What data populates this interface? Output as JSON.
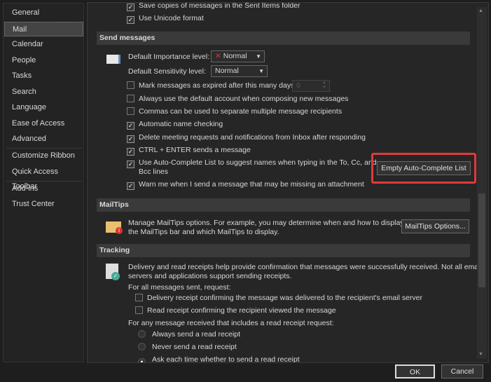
{
  "sidebar": {
    "items": [
      {
        "label": "General"
      },
      {
        "label": "Mail",
        "selected": true
      },
      {
        "label": "Calendar"
      },
      {
        "label": "People"
      },
      {
        "label": "Tasks"
      },
      {
        "label": "Search"
      },
      {
        "label": "Language"
      },
      {
        "label": "Ease of Access"
      },
      {
        "label": "Advanced"
      },
      {
        "label": "Customize Ribbon"
      },
      {
        "label": "Quick Access Toolbar"
      },
      {
        "label": "Add-ins"
      },
      {
        "label": "Trust Center"
      }
    ]
  },
  "top": {
    "save_copies": {
      "label": "Save copies of messages in the Sent Items folder",
      "checked": true
    },
    "unicode": {
      "label": "Use Unicode format",
      "checked": true
    }
  },
  "send": {
    "header": "Send messages",
    "importance_label": "Default Importance level:",
    "importance_value": "Normal",
    "sensitivity_label": "Default Sensitivity level:",
    "sensitivity_value": "Normal",
    "expire": {
      "label": "Mark messages as expired after this many days:",
      "checked": false,
      "value": "0"
    },
    "options": [
      {
        "label": "Always use the default account when composing new messages",
        "checked": false
      },
      {
        "label": "Commas can be used to separate multiple message recipients",
        "checked": false
      },
      {
        "label": "Automatic name checking",
        "checked": true
      },
      {
        "label": "Delete meeting requests and notifications from Inbox after responding",
        "checked": true
      },
      {
        "label": "CTRL + ENTER sends a message",
        "checked": true
      }
    ],
    "autocomplete": {
      "label": "Use Auto-Complete List to suggest names when typing in the To, Cc, and",
      "label2": "Bcc lines",
      "checked": true
    },
    "empty_button": "Empty Auto-Complete List",
    "warn": {
      "label": "Warn me when I send a message that may be missing an attachment",
      "checked": true
    }
  },
  "mailtips": {
    "header": "MailTips",
    "text1": "Manage MailTips options. For example, you may determine when and how to display",
    "text2": "the MailTips bar and which MailTips to display.",
    "button": "MailTips Options..."
  },
  "tracking": {
    "header": "Tracking",
    "text1": "Delivery and read receipts help provide confirmation that messages were successfully received. Not all email",
    "text2": "servers and applications support sending receipts.",
    "for_all": "For all messages sent, request:",
    "delivery": {
      "label": "Delivery receipt confirming the message was delivered to the recipient's email server",
      "checked": false
    },
    "read": {
      "label": "Read receipt confirming the recipient viewed the message",
      "checked": false
    },
    "for_any": "For any message received that includes a read receipt request:",
    "radios": [
      {
        "label": "Always send a read receipt",
        "selected": false
      },
      {
        "label": "Never send a read receipt",
        "selected": false
      },
      {
        "label": "Ask each time whether to send a read receipt",
        "selected": true
      }
    ]
  },
  "footer": {
    "ok": "OK",
    "cancel": "Cancel"
  },
  "colors": {
    "highlight": "#e0393e",
    "background": "#262626"
  }
}
